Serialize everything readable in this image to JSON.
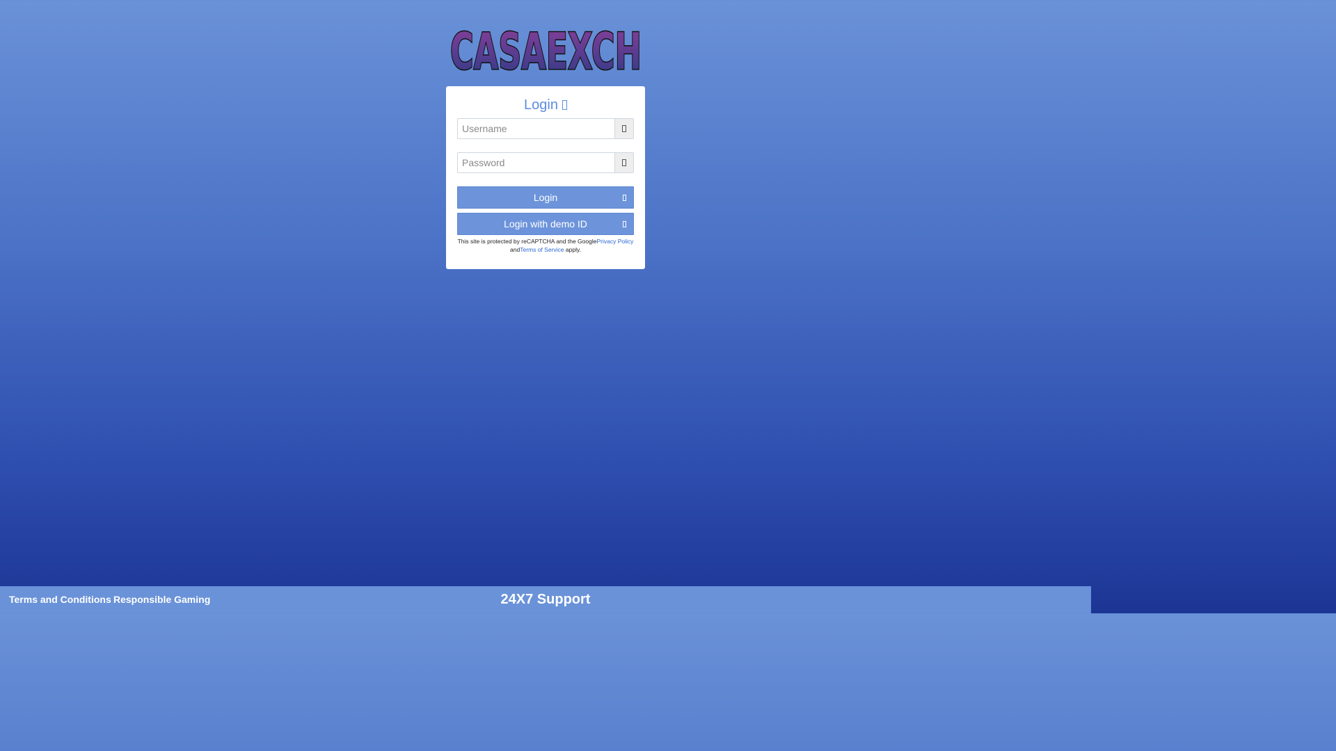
{
  "brand": {
    "logo_text": "CASAEXCH",
    "colors": {
      "logo_top": "#8a3f9a",
      "logo_bottom": "#2f3a86",
      "logo_stroke": "#111111"
    }
  },
  "login": {
    "title": "Login",
    "title_icon": "sign-in-icon",
    "username_placeholder": "Username",
    "username_icon": "user-icon",
    "password_placeholder": "Password",
    "password_icon": "key-icon",
    "login_button": "Login",
    "login_button_icon": "sign-in-icon",
    "demo_button": "Login with demo ID",
    "demo_button_icon": "sign-in-icon"
  },
  "recaptcha": {
    "text_before": "This site is protected by reCAPTCHA and the Google",
    "privacy_link": "Privacy Policy",
    "text_and": "and",
    "terms_link": "Terms of Service",
    "text_after": " apply."
  },
  "footer": {
    "terms": "Terms and Conditions",
    "responsible": "Responsible Gaming",
    "support": "24X7 Support"
  },
  "colors": {
    "accent": "#6d94db",
    "title": "#5b8ddd",
    "footer_bg": "#6a92d8",
    "link": "#2a67d4"
  }
}
